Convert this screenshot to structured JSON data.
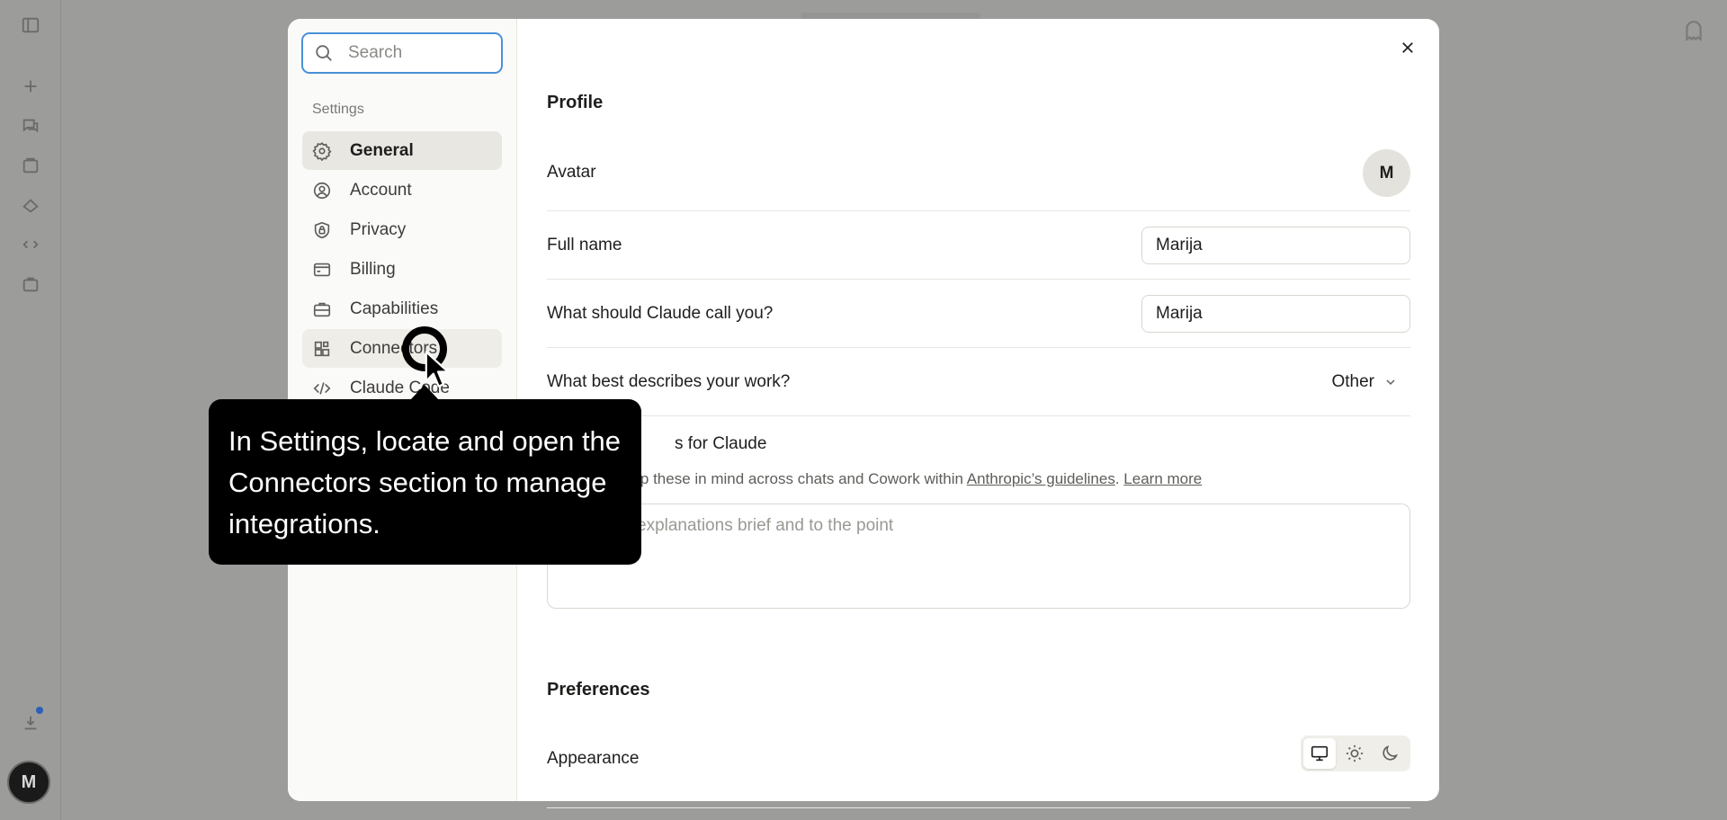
{
  "search": {
    "placeholder": "Search"
  },
  "sidebar": {
    "heading": "Settings",
    "items": [
      {
        "label": "General",
        "icon": "gear-icon"
      },
      {
        "label": "Account",
        "icon": "user-circle-icon"
      },
      {
        "label": "Privacy",
        "icon": "shield-lock-icon"
      },
      {
        "label": "Billing",
        "icon": "credit-card-icon"
      },
      {
        "label": "Capabilities",
        "icon": "briefcase-icon"
      },
      {
        "label": "Connectors",
        "icon": "grid-plus-icon"
      },
      {
        "label": "Claude Code",
        "icon": "code-icon"
      }
    ]
  },
  "profile": {
    "title": "Profile",
    "avatar_label": "Avatar",
    "avatar_initial": "M",
    "full_name_label": "Full name",
    "full_name_value": "Marija",
    "nickname_label": "What should Claude call you?",
    "nickname_value": "Marija",
    "work_label": "What best describes your work?",
    "work_value": "Other",
    "instructions_label_visible": "s for Claude",
    "instructions_help_visible": "eep these in mind across chats and Cowork within ",
    "guidelines_link": "Anthropic’s guidelines",
    "help_period": ". ",
    "learn_more": "Learn more",
    "instructions_placeholder_visible": "explanations brief and to the point"
  },
  "preferences": {
    "title": "Preferences",
    "appearance_label": "Appearance",
    "appearance_options": [
      "monitor-icon",
      "sun-icon",
      "moon-icon"
    ],
    "appearance_selected": "monitor-icon"
  },
  "tooltip": {
    "text": "In Settings, locate and open the Connectors section to manage integrations."
  },
  "rail": {
    "avatar_initial": "M"
  },
  "colors": {
    "backdrop": "#9c9c9b",
    "focus_ring": "#4a90d9",
    "active_nav": "#e9e7e2",
    "tooltip_bg": "#000000"
  }
}
